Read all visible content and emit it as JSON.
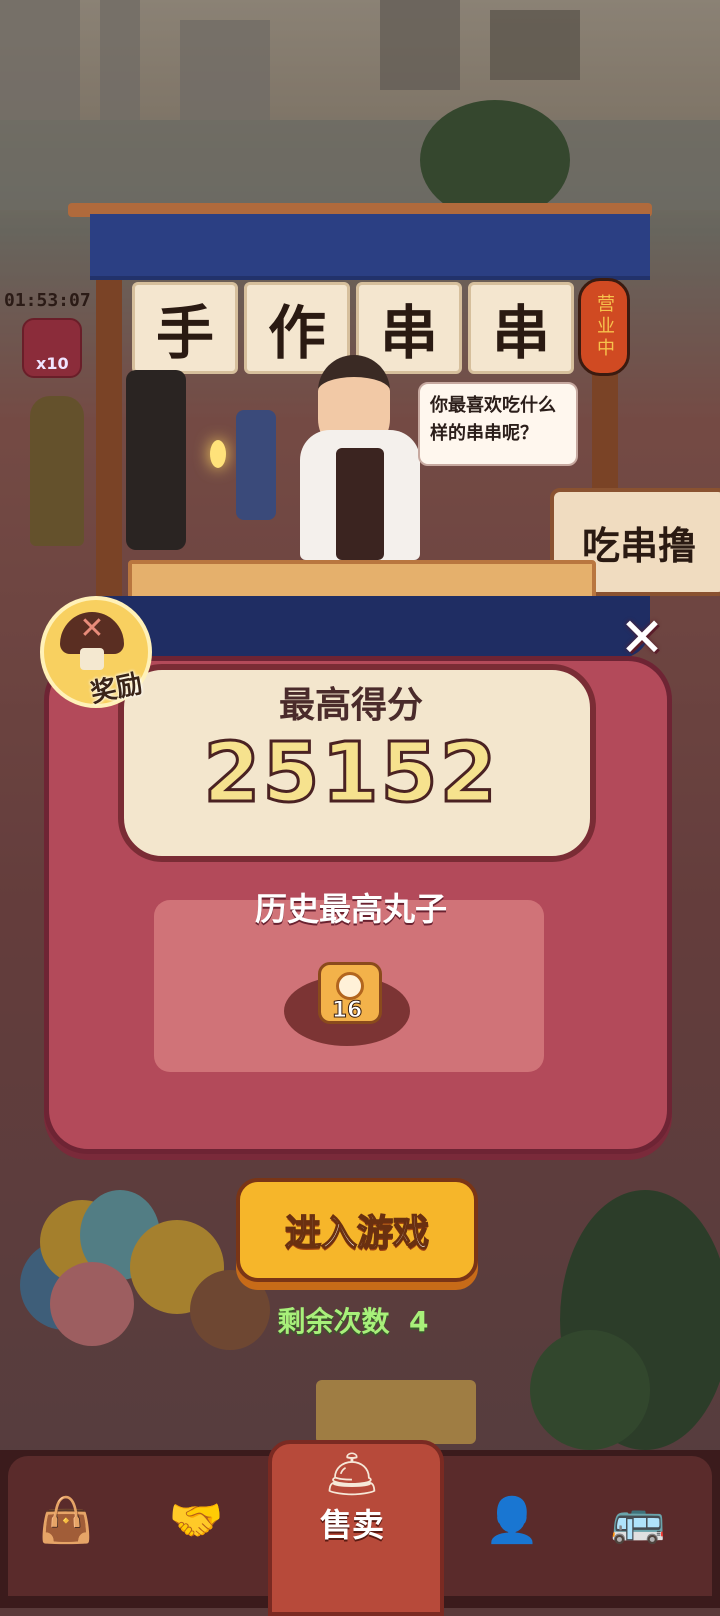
{
  "hud": {
    "timer": "01:53:07",
    "gem_count": "x10"
  },
  "stall": {
    "sign_chars": [
      "手",
      "作",
      "串",
      "串"
    ],
    "lantern_text": "营业中",
    "speech_bubble": "你最喜欢吃什么样的串串呢？",
    "side_sign": "吃串撸"
  },
  "reward_badge": {
    "label": "奖励",
    "icon": "mushroom-icon"
  },
  "panel": {
    "best_score_title": "最高得分",
    "best_score_value": "25152",
    "history_title": "历史最高丸子",
    "meatball_count": "16"
  },
  "actions": {
    "enter_game_label": "进入游戏",
    "remaining_label": "剩余次数",
    "remaining_count": "4"
  },
  "bottom_nav": {
    "items": [
      {
        "icon": "bag-icon"
      },
      {
        "icon": "handshake-icon"
      },
      {
        "icon": "food-cloche-icon",
        "label": "售卖",
        "active": true
      },
      {
        "icon": "chef-card-icon"
      },
      {
        "icon": "bus-icon"
      }
    ]
  },
  "colors": {
    "panel": "#b34a5a",
    "button": "#f6b62a",
    "remaining_text": "#a8f07a",
    "score_text": "#f6e28e"
  }
}
